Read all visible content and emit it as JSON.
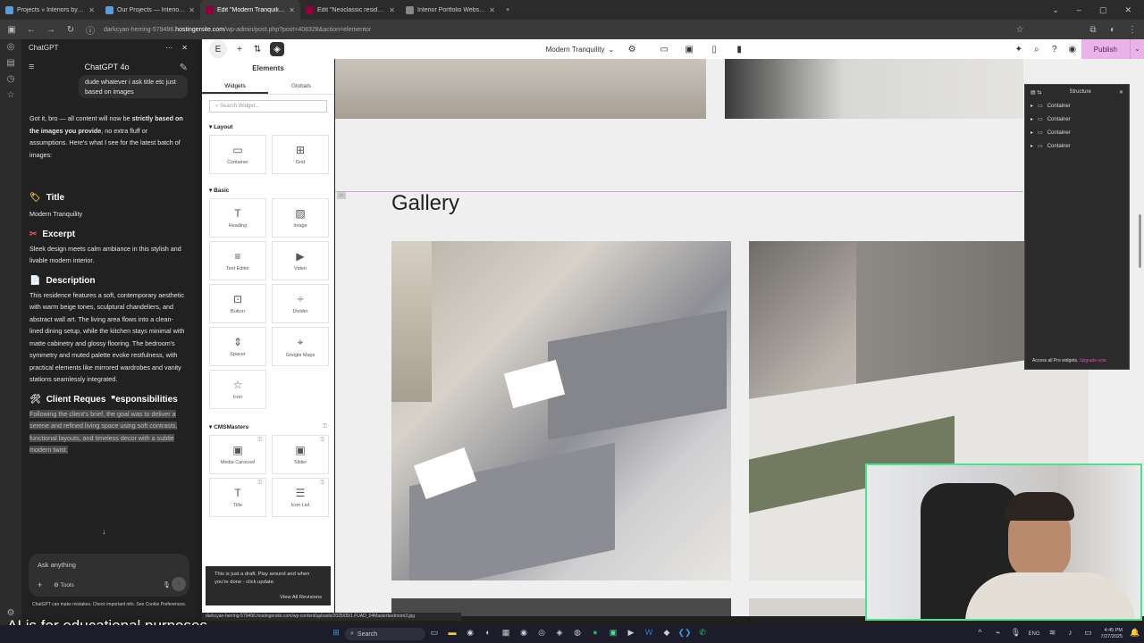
{
  "browser": {
    "tabs": [
      {
        "label": "Projects » Interiors by Gunay —"
      },
      {
        "label": "Our Projects — Interiors by Gun"
      },
      {
        "label": "Edit \"Modern Tranquility\" with"
      },
      {
        "label": "Edit \"Neoclassic residence\" with"
      },
      {
        "label": "Interior Portfolio Website"
      }
    ],
    "url_prefix": "darkcyan-herring-579496.",
    "url_domain": "hostingersite.com",
    "url_path": "/wp-admin/post.php?post=408328&action=elementor",
    "status_url": "darkcyan-herring-579496.hostingersite.com/wp-content/uploads/2025/05/1.FUAD_04Masterbedroom3.jpg"
  },
  "chatgpt": {
    "header_title": "ChatGPT 4o",
    "user_message": "dude whatever i ask title etc just based on images",
    "intro_pre": "Got it, bro — all content will now be ",
    "intro_bold": "strictly based on the images you provide",
    "intro_post": ", no extra fluff or assumptions. Here's what I see for the latest batch of images:",
    "title_heading": "Title",
    "title_value": "Modern Tranquility",
    "excerpt_heading": "Excerpt",
    "excerpt_value": "Sleek design meets calm ambiance in this stylish and livable modern interior.",
    "description_heading": "Description",
    "description_value": "This residence features a soft, contemporary aesthetic with warm beige tones, sculptural chandeliers, and abstract wall art. The living area flows into a clean-lined dining setup, while the kitchen stays minimal with matte cabinetry and glossy flooring. The bedroom's symmetry and muted palette evoke restfulness, with practical elements like mirrored wardrobes and vanity stations seamlessly integrated.",
    "client_heading": "Client Reques",
    "client_heading_rest": "esponsibilities",
    "client_value": "Following the client's brief, the goal was to deliver a serene and refined living space using soft contrasts, functional layouts, and timeless decor with a subtle modern twist.",
    "input_placeholder": "Ask anything",
    "tools_label": "Tools",
    "footer_note": "ChatGPT can make mistakes. Check important info. See Cookie Preferences."
  },
  "elementor": {
    "page_name": "Modern Tranquility",
    "publish_label": "Publish",
    "panel_title": "Elements",
    "tab_widgets": "Widgets",
    "tab_globals": "Globals",
    "search_placeholder": "Search Widget...",
    "cat_layout": "Layout",
    "cat_basic": "Basic",
    "cat_cmsmasters": "CMSMasters",
    "layout_widgets": [
      {
        "label": "Container",
        "icon": "▭"
      },
      {
        "label": "Grid",
        "icon": "⊞"
      }
    ],
    "basic_widgets": [
      {
        "label": "Heading",
        "icon": "T"
      },
      {
        "label": "Image",
        "icon": "▨"
      },
      {
        "label": "Text Editor",
        "icon": "≡"
      },
      {
        "label": "Video",
        "icon": "▶"
      },
      {
        "label": "Button",
        "icon": "⊡"
      },
      {
        "label": "Divider",
        "icon": "÷"
      },
      {
        "label": "Spacer",
        "icon": "⇕"
      },
      {
        "label": "Google Maps",
        "icon": "⌖"
      },
      {
        "label": "Icon",
        "icon": "☆"
      }
    ],
    "cms_widgets": [
      {
        "label": "Media Carousel",
        "icon": "▣"
      },
      {
        "label": "Slider",
        "icon": "▣"
      },
      {
        "label": "Title",
        "icon": "T"
      },
      {
        "label": "Icon List",
        "icon": "☰"
      }
    ],
    "draft_notice": "This is just a draft. Play around and when you're done - click update.",
    "view_revisions": "View All Revisions",
    "gallery_heading": "Gallery",
    "structure_title": "Structure",
    "structure_items": [
      "Container",
      "Container",
      "Container",
      "Container"
    ],
    "pro_notice": "Access all Pro widgets.",
    "pro_link": "Upgrade now"
  },
  "overlay": {
    "caption": "AI is for educational purposes"
  },
  "taskbar": {
    "search_label": "Search",
    "lang": "ENG",
    "time": "4:45 PM",
    "date": "7/27/2025"
  },
  "colors": {
    "publish_bg": "#e8b4e8",
    "webcam_border": "#4be38f",
    "highlight": "#4a4a4a"
  }
}
